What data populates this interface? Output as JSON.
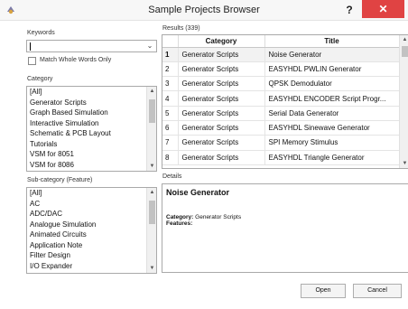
{
  "window": {
    "title": "Sample Projects Browser",
    "help_label": "?",
    "close_label": "✕"
  },
  "keywords": {
    "label": "Keywords",
    "value": "",
    "match_whole_words_label": "Match Whole Words Only",
    "match_whole_words_checked": false
  },
  "category": {
    "label": "Category",
    "items": [
      "[All]",
      "Generator Scripts",
      "Graph Based Simulation",
      "Interactive Simulation",
      "Schematic & PCB Layout",
      "Tutorials",
      "VSM for 8051",
      "VSM for 8086"
    ]
  },
  "subcategory": {
    "label": "Sub-category (Feature)",
    "items": [
      "[All]",
      "AC",
      "ADC/DAC",
      "Analogue Simulation",
      "Animated Circuits",
      "Application Note",
      "Filter Design",
      "I/O Expander"
    ]
  },
  "results": {
    "label": "Results (339)",
    "columns": [
      "",
      "Category",
      "Title"
    ],
    "rows": [
      {
        "num": "1",
        "category": "Generator Scripts",
        "title": "Noise Generator"
      },
      {
        "num": "2",
        "category": "Generator Scripts",
        "title": "EASYHDL PWLIN Generator"
      },
      {
        "num": "3",
        "category": "Generator Scripts",
        "title": "QPSK Demodulator"
      },
      {
        "num": "4",
        "category": "Generator Scripts",
        "title": "EASYHDL ENCODER Script Progr..."
      },
      {
        "num": "5",
        "category": "Generator Scripts",
        "title": "Serial Data Generator"
      },
      {
        "num": "6",
        "category": "Generator Scripts",
        "title": "EASYHDL Sinewave Generator"
      },
      {
        "num": "7",
        "category": "Generator Scripts",
        "title": "SPI Memory Stimulus"
      },
      {
        "num": "8",
        "category": "Generator Scripts",
        "title": "EASYHDL Triangle Generator"
      }
    ]
  },
  "details": {
    "label": "Details",
    "title": "Noise Generator",
    "category_label": "Category:",
    "category_value": "Generator Scripts",
    "features_label": "Features:",
    "features_value": ""
  },
  "buttons": {
    "open": "Open",
    "cancel": "Cancel"
  },
  "colors": {
    "close_button": "#e04343",
    "selected_row": "#f2f2f2"
  }
}
